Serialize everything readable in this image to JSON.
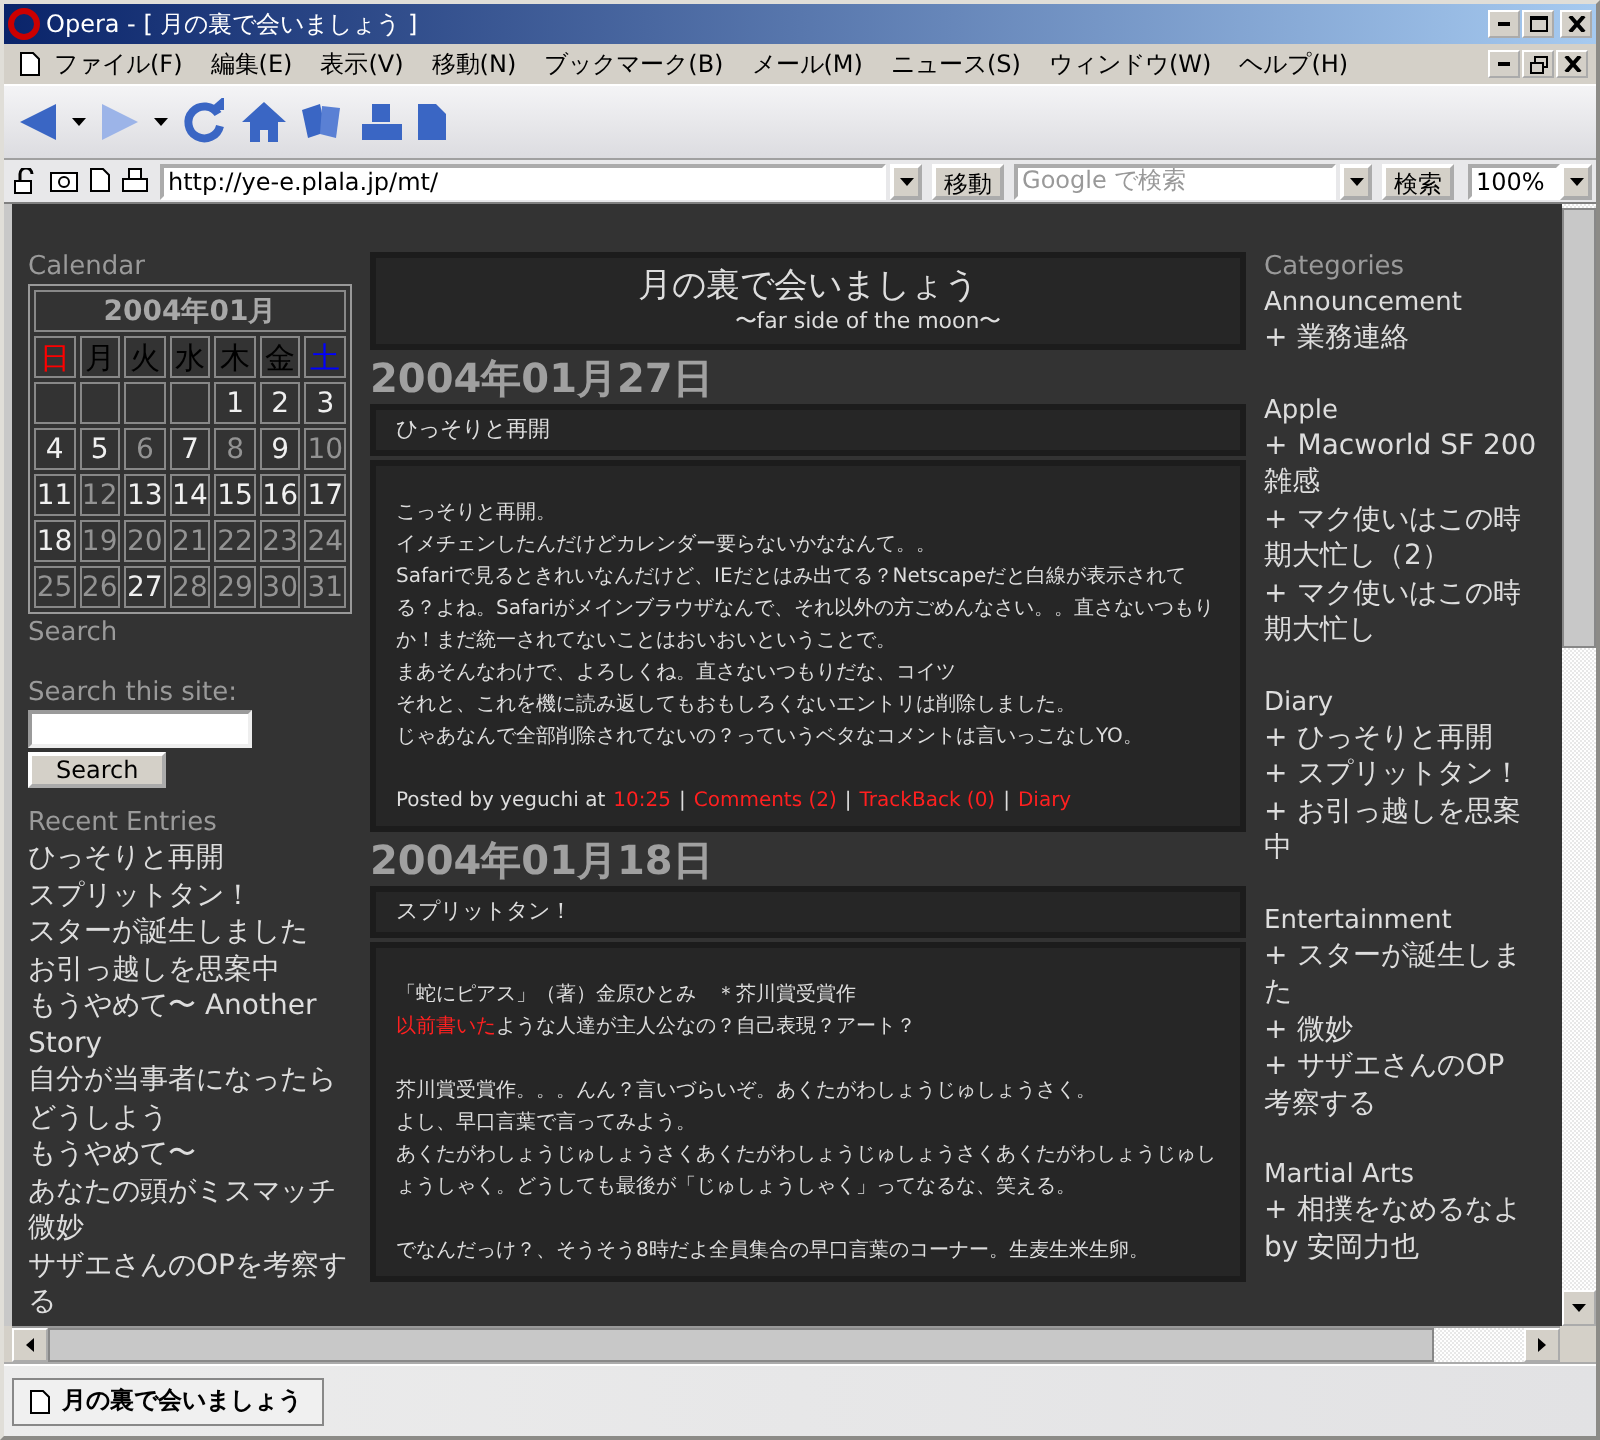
{
  "window": {
    "title": "Opera - [ 月の裏で会いましょう ]"
  },
  "menu_bar": {
    "items": [
      "ファイル(F)",
      "編集(E)",
      "表示(V)",
      "移動(N)",
      "ブックマーク(B)",
      "メール(M)",
      "ニュース(S)",
      "ウィンドウ(W)",
      "ヘルプ(H)"
    ]
  },
  "address_bar": {
    "url": "http://ye-e.plala.jp/mt/",
    "go_button": "移動",
    "search": {
      "placeholder": "Google で検索"
    },
    "search_button": "検索",
    "zoom": "100%"
  },
  "sidebar_left": {
    "calendar": {
      "heading": "Calendar",
      "month": "2004年01月",
      "weekdays": [
        {
          "label": "日",
          "color": "#ff0000"
        },
        {
          "label": "月",
          "color": "#000000"
        },
        {
          "label": "火",
          "color": "#000000"
        },
        {
          "label": "水",
          "color": "#000000"
        },
        {
          "label": "木",
          "color": "#000000"
        },
        {
          "label": "金",
          "color": "#000000"
        },
        {
          "label": "土",
          "color": "#0000ff"
        }
      ],
      "weeks": [
        [
          {
            "kind": "blank"
          },
          {
            "kind": "blank"
          },
          {
            "kind": "blank"
          },
          {
            "kind": "blank"
          },
          {
            "day": "1",
            "linked": true
          },
          {
            "day": "2",
            "linked": true
          },
          {
            "day": "3",
            "linked": true
          }
        ],
        [
          {
            "day": "4",
            "linked": true
          },
          {
            "day": "5",
            "linked": true
          },
          {
            "day": "6",
            "linked": false
          },
          {
            "day": "7",
            "linked": true
          },
          {
            "day": "8",
            "linked": false
          },
          {
            "day": "9",
            "linked": true
          },
          {
            "day": "10",
            "linked": false
          }
        ],
        [
          {
            "day": "11",
            "linked": true
          },
          {
            "day": "12",
            "linked": false
          },
          {
            "day": "13",
            "linked": true
          },
          {
            "day": "14",
            "linked": true
          },
          {
            "day": "15",
            "linked": true
          },
          {
            "day": "16",
            "linked": true
          },
          {
            "day": "17",
            "linked": true
          }
        ],
        [
          {
            "day": "18",
            "linked": true
          },
          {
            "day": "19",
            "linked": false
          },
          {
            "day": "20",
            "linked": false
          },
          {
            "day": "21",
            "linked": false
          },
          {
            "day": "22",
            "linked": false
          },
          {
            "day": "23",
            "linked": false
          },
          {
            "day": "24",
            "linked": false
          }
        ],
        [
          {
            "day": "25",
            "linked": false
          },
          {
            "day": "26",
            "linked": false
          },
          {
            "day": "27",
            "linked": true
          },
          {
            "day": "28",
            "linked": false
          },
          {
            "day": "29",
            "linked": false
          },
          {
            "day": "30",
            "linked": false
          },
          {
            "day": "31",
            "linked": false
          }
        ]
      ]
    },
    "search": {
      "heading": "Search",
      "label": "Search this site:",
      "button": "Search"
    },
    "recent_entries": {
      "heading": "Recent Entries",
      "items": [
        "ひっそりと再開",
        "スプリットタン！",
        "スターが誕生しました",
        "お引っ越しを思案中",
        "もうやめて〜 Another Story",
        "自分が当事者になったらどうしよう",
        "もうやめて〜",
        "あなたの頭がミスマッチ",
        "微妙",
        "サザエさんのOPを考察する"
      ]
    }
  },
  "header": {
    "title": "月の裏で会いましょう",
    "subtitle": "〜far side of the moon〜"
  },
  "days": [
    {
      "date": "2004年01月27日",
      "entry_title": "ひっそりと再開",
      "paragraphs": [
        [
          "こっそりと再開。",
          "イメチェンしたんだけどカレンダー要らないかななんて。。",
          "Safariで見るときれいなんだけど、IEだとはみ出てる？Netscapeだと白線が表示されてる？よね。Safariがメインブラウザなんで、それ以外の方ごめんなさい。。直さないつもりか！まだ統一されてないことはおいおいということで。",
          "まあそんなわけで、よろしくね。直さないつもりだな、コイツ",
          "それと、これを機に読み返してもおもしろくないエントリは削除しました。",
          "じゃあなんで全部削除されてないの？っていうベタなコメントは言いっこなしYO。"
        ]
      ],
      "footer": [
        {
          "kind": "text",
          "text": "Posted by yeguchi at"
        },
        {
          "kind": "link",
          "text": "10:25"
        },
        {
          "kind": "sep",
          "text": "|"
        },
        {
          "kind": "link",
          "text": "Comments (2)"
        },
        {
          "kind": "sep",
          "text": "|"
        },
        {
          "kind": "link",
          "text": "TrackBack (0)"
        },
        {
          "kind": "sep",
          "text": "|"
        },
        {
          "kind": "link",
          "text": "Diary"
        }
      ]
    },
    {
      "date": "2004年01月18日",
      "entry_title": "スプリットタン！",
      "paragraphs": [
        [
          "「蛇にピアス」（著）金原ひとみ　＊芥川賞受賞作",
          {
            "link": "以前書いた",
            "text": "ような人達が主人公なの？自己表現？アート？"
          }
        ],
        [
          "芥川賞受賞作。。。んん？言いづらいぞ。あくたがわしょうじゅしょうさく。",
          "よし、早口言葉で言ってみよう。",
          "あくたがわしょうじゅしょうさくあくたがわしょうじゅしょうさくあくたがわしょうじゅしょうしゃく。どうしても最後が「じゅしょうしゃく」ってなるな、笑える。"
        ],
        [
          "でなんだっけ？、そうそう8時だよ全員集合の早口言葉のコーナー。生麦生米生卵。"
        ]
      ]
    }
  ],
  "sidebar_right": {
    "heading": "Categories",
    "categories": [
      {
        "name": "Announcement",
        "entries": [
          {
            "marker": "+",
            "lines": [
              "業務連絡"
            ]
          }
        ]
      },
      {
        "name": "Apple",
        "entries": [
          {
            "marker": "+",
            "lines": [
              "Macworld SF 200",
              "雑感"
            ]
          },
          {
            "marker": "+",
            "lines": [
              "マク使いはこの時",
              "期大忙し（2）"
            ]
          },
          {
            "marker": "+",
            "lines": [
              "マク使いはこの時",
              "期大忙し"
            ]
          }
        ]
      },
      {
        "name": "Diary",
        "entries": [
          {
            "marker": "+",
            "lines": [
              "ひっそりと再開"
            ]
          },
          {
            "marker": "+",
            "lines": [
              "スプリットタン！"
            ]
          },
          {
            "marker": "+",
            "lines": [
              "お引っ越しを思案",
              "中"
            ]
          }
        ]
      },
      {
        "name": "Entertainment",
        "entries": [
          {
            "marker": "+",
            "lines": [
              "スターが誕生しま",
              "た"
            ]
          },
          {
            "marker": "+",
            "lines": [
              "微妙"
            ]
          },
          {
            "marker": "+",
            "lines": [
              "サザエさんのOP",
              "考察する"
            ]
          }
        ]
      },
      {
        "name": "Martial Arts",
        "entries": [
          {
            "marker": "+",
            "lines": [
              "相撲をなめるなよ",
              "by 安岡力也"
            ]
          }
        ]
      }
    ]
  },
  "status_bar": {
    "tab": "月の裏で会いましょう"
  }
}
